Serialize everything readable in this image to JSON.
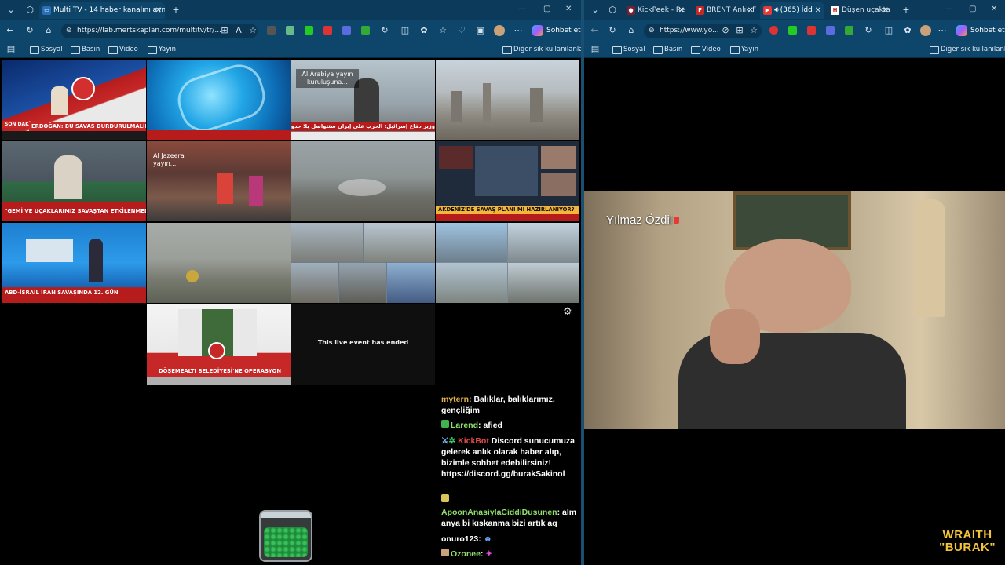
{
  "left_window": {
    "tabs": [
      {
        "label": "Multi TV - 14 haber kanalını aynı a",
        "active": true
      }
    ],
    "address": "https://lab.mertskaplan.com/multitv/tr/...",
    "chat_button": "Sohbet et",
    "favorites": [
      "Sosyal",
      "Basın",
      "Video",
      "Yayın"
    ],
    "other_favorites": "Diğer sık kullanılanlar",
    "grid": {
      "cell1_caption": "ERDOĞAN: BU SAVAŞ DURDURULMALIDIR",
      "cell1_badge": "SON DAKİKA",
      "cell3_overlay": "Al Arabiya yayın kuruluşuna...",
      "cell3_caption": "وزير دفاع إسرائيل: الحرب على إيران ستتواصل بلا حدود زمنية",
      "cell5_caption": "\"GEMİ VE UÇAKLARIMIZ SAVAŞTAN ETKİLENMEDİ\"",
      "cell6_overlay": "Al Jazeera yayın...",
      "cell8_caption": "AKDENİZ'DE SAVAŞ PLANI MI HAZIRLANIYOR?",
      "cell9_caption": "ABD-İSRAİL İRAN SAVAŞINDA 12. GÜN",
      "cell13_caption": "DÖŞEMEALTI BELEDİYESİ'NE OPERASYON",
      "ended_text": "This live event has ended"
    },
    "chat": {
      "messages": [
        {
          "user": "mytern",
          "text": "Balıklar, balıklarımız, gençliğim"
        },
        {
          "user": "Larend",
          "text": "afied"
        },
        {
          "user": "KickBot",
          "text": "Discord sunucumuza gelerek anlık olarak haber alıp, bizimle sohbet edebilirsiniz! https://discord.gg/burakSakinol"
        },
        {
          "user": "ApoonAnasiylaCiddiDusunen",
          "text": "alm anya bi kıskanma bizi artık aq"
        },
        {
          "user": "onuro123",
          "text": ""
        },
        {
          "user": "Ozonee",
          "text": ""
        }
      ]
    }
  },
  "right_window": {
    "tabs": [
      {
        "label": "KickPeek - Re",
        "active": false
      },
      {
        "label": "BRENT Anlık F",
        "active": false
      },
      {
        "label": "(365) İdd",
        "active": true
      },
      {
        "label": "Düşen uçakta",
        "active": false
      }
    ],
    "address": "https://www.yo...",
    "chat_button": "Sohbet et",
    "favorites": [
      "Sosyal",
      "Basın",
      "Video",
      "Yayın"
    ],
    "other_favorites": "Diğer sık kullanılanlar",
    "video_name_plate": "Yılmaz Özdil",
    "watermark_line1": "WRAITH",
    "watermark_line2": "\"BURAK\""
  },
  "colors": {
    "titlebar": "#0b3a5b",
    "toolbar": "#0d456b",
    "accent": "#d32f2f",
    "chat_name": "#8ee06a"
  }
}
